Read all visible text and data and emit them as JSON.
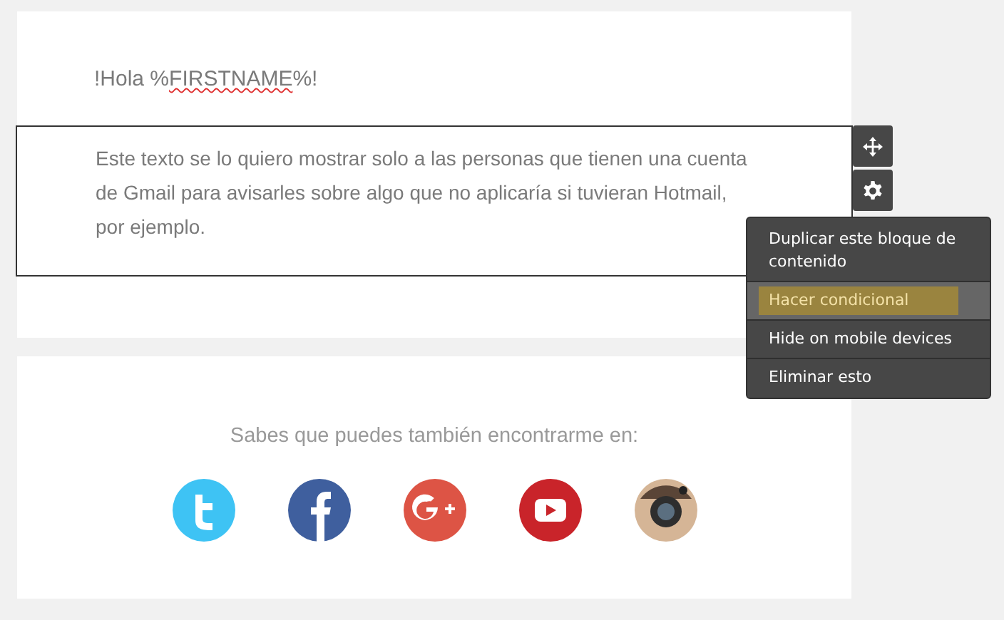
{
  "greeting": {
    "parts": [
      {
        "text": "!Hola %",
        "misspelled": false
      },
      {
        "text": "FIRSTNAME",
        "misspelled": true
      },
      {
        "text": "%!",
        "misspelled": false
      }
    ]
  },
  "selected_block": {
    "text": "Este texto se lo quiero mostrar solo a las personas que tienen una cuenta de Gmail para avisarles sobre algo que no aplicaría si tuvieran Hotmail, por ejemplo."
  },
  "block_toolbar": [
    {
      "kind": "move"
    },
    {
      "kind": "settings"
    }
  ],
  "context_menu": [
    {
      "label": "Duplicar este bloque de contenido",
      "selected": false
    },
    {
      "label": "Hacer condicional",
      "selected": true
    },
    {
      "label": "Hide on mobile devices",
      "selected": false
    },
    {
      "label": "Eliminar esto",
      "selected": false
    }
  ],
  "footer": {
    "text": "Sabes que puedes también encontrarme en:",
    "social_links": [
      {
        "kind": "twitter"
      },
      {
        "kind": "facebook"
      },
      {
        "kind": "google-plus"
      },
      {
        "kind": "youtube"
      },
      {
        "kind": "instagram"
      }
    ]
  }
}
